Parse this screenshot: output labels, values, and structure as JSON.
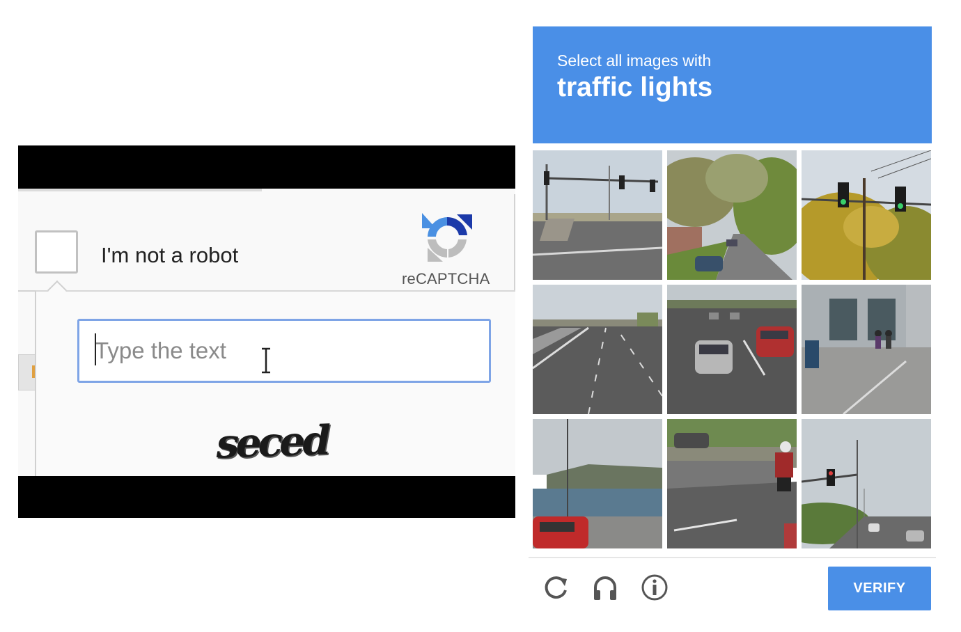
{
  "checkbox_widget": {
    "label": "I'm not a robot",
    "brand": "reCAPTCHA",
    "logo_icon": "recaptcha-logo-icon",
    "text_input": {
      "value": "",
      "placeholder": "Type the text"
    },
    "captcha_word": "seced"
  },
  "image_challenge": {
    "prompt_line1": "Select all images with",
    "prompt_line2": "traffic lights",
    "header_color": "#4a8fe7",
    "tiles": [
      {
        "scene": "intersection with traffic lights"
      },
      {
        "scene": "residential street with trees"
      },
      {
        "scene": "traffic lights over trees"
      },
      {
        "scene": "highway"
      },
      {
        "scene": "cars on road"
      },
      {
        "scene": "building with pedestrians"
      },
      {
        "scene": "waterfront with red car"
      },
      {
        "scene": "road with motorcycle"
      },
      {
        "scene": "road with traffic light"
      }
    ],
    "footer": {
      "icons": [
        "reload-icon",
        "audio-icon",
        "info-icon"
      ],
      "verify_label": "VERIFY"
    }
  }
}
